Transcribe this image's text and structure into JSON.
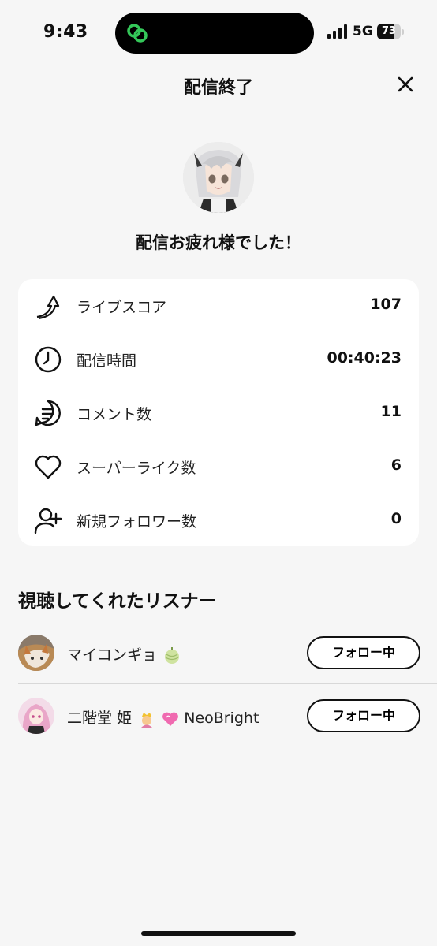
{
  "status_bar": {
    "time": "9:43",
    "network": "5G",
    "battery": "73",
    "battery_level": 0.73
  },
  "header": {
    "title": "配信終了",
    "close_icon": "close-icon"
  },
  "profile": {
    "message": "配信お疲れ様でした！"
  },
  "stats": [
    {
      "icon": "live-score-icon",
      "label": "ライブスコア",
      "value": "107"
    },
    {
      "icon": "clock-icon",
      "label": "配信時間",
      "value": "00:40:23"
    },
    {
      "icon": "comment-icon",
      "label": "コメント数",
      "value": "11"
    },
    {
      "icon": "heart-icon",
      "label": "スーパーライク数",
      "value": "6"
    },
    {
      "icon": "add-user-icon",
      "label": "新規フォロワー数",
      "value": "0"
    }
  ],
  "listeners": {
    "title": "視聴してくれたリスナー",
    "items": [
      {
        "name": "マイコンギョ",
        "emoji": "melon-icon",
        "button": "フォロー中"
      },
      {
        "name_part1": "二階堂 姫",
        "emoji1": "princess-icon",
        "emoji2": "pink-heart-icon",
        "name_part2": "NeoBright",
        "button": "フォロー中"
      }
    ]
  },
  "colors": {
    "accent_green": "#34c759",
    "background": "#f6f6f6",
    "card": "#ffffff"
  }
}
